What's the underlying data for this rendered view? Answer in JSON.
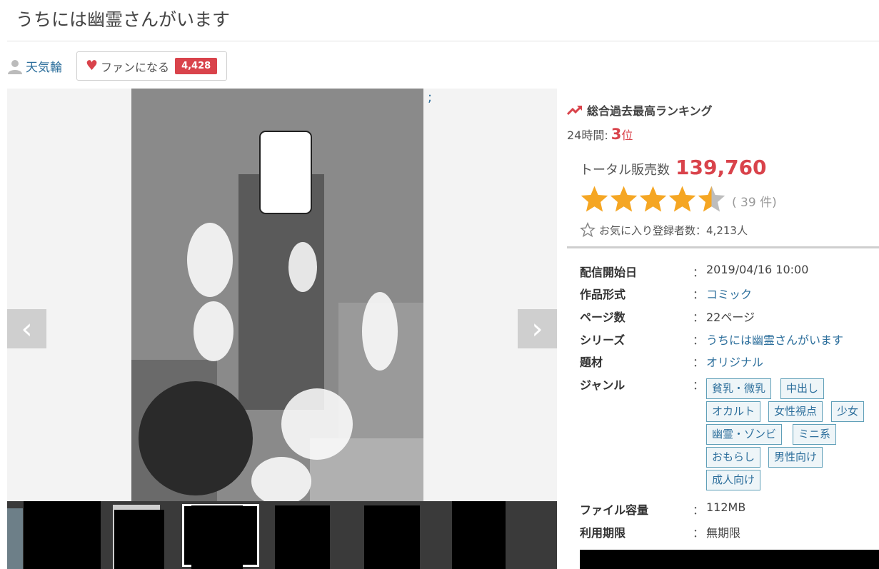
{
  "title": "うちには幽霊さんがいます",
  "author": {
    "name": "天気輪",
    "icon": "user-icon"
  },
  "fan_button": {
    "label": "ファンになる",
    "count": "4,428",
    "icon": "heart-icon"
  },
  "viewer": {
    "semicolon": ";",
    "prev_icon": "chevron-left-icon",
    "next_icon": "chevron-right-icon",
    "prev_glyph": "‹",
    "next_glyph": "›"
  },
  "ranking": {
    "heading": "総合過去最高ランキング",
    "period_label": "24時間:",
    "rank": "3",
    "rank_unit": "位"
  },
  "sales": {
    "label": "トータル販売数",
    "value": "139,760"
  },
  "rating": {
    "stars": 4.5,
    "max": 5,
    "count_text": "( 39 件)",
    "star_color": "#f5a623"
  },
  "favorites": {
    "text": "お気に入り登録者数：4,213人",
    "icon": "star-outline-icon"
  },
  "info": {
    "release": {
      "label": "配信開始日",
      "value": "2019/04/16 10:00"
    },
    "format": {
      "label": "作品形式",
      "value": "コミック"
    },
    "pages": {
      "label": "ページ数",
      "value": "22ページ"
    },
    "series": {
      "label": "シリーズ",
      "value": "うちには幽霊さんがいます"
    },
    "subject": {
      "label": "題材",
      "value": "オリジナル"
    },
    "genre": {
      "label": "ジャンル"
    },
    "filesize": {
      "label": "ファイル容量",
      "value": "112MB"
    },
    "period": {
      "label": "利用期限",
      "value": "無期限"
    },
    "colon": "："
  },
  "genre_tags": [
    "貧乳・微乳",
    "中出し",
    "オカルト",
    "女性視点",
    "少女",
    "幽霊・ゾンビ",
    "ミニ系",
    "おもらし",
    "男性向け",
    "成人向け"
  ],
  "colors": {
    "accent_red": "#d9434b",
    "link_blue": "#2d6f9c"
  }
}
